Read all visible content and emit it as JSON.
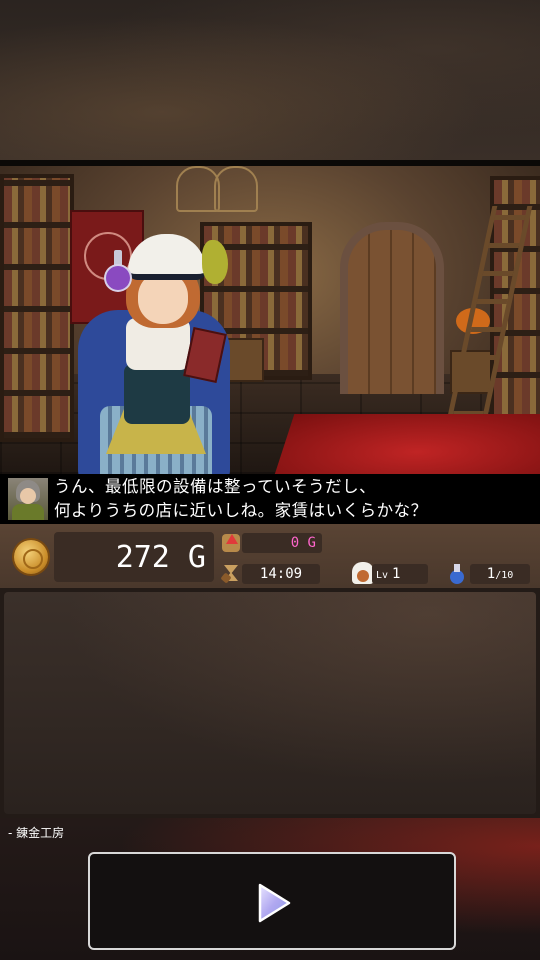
{
  "dialogue": {
    "line1": "うん、最低限の設備は整っていそうだし、",
    "line2": "何よりうちの店に近いしね。家賃はいくらかな？"
  },
  "status": {
    "gold": "272 G",
    "income": "0 G",
    "time": "14:09",
    "level_label": "Lv",
    "level": "1",
    "stock": "1",
    "stock_max": "/10"
  },
  "bottom": {
    "section_label": "- 錬金工房"
  },
  "icons": [
    "coin-icon",
    "arrow-up-icon",
    "hourglass-icon",
    "character-portrait-icon",
    "potion-icon",
    "play-icon"
  ],
  "colors": {
    "income_text": "#ff66cc",
    "play_button_border": "#d8d8d8"
  }
}
